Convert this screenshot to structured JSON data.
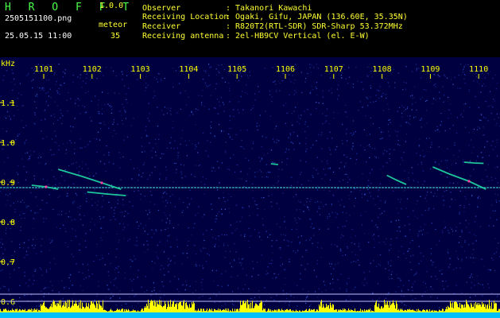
{
  "header": {
    "app_title": "H R O F F T",
    "app_version": "1.0.0",
    "file_name": "2505151100.png",
    "date_time": "25.05.15 11:00",
    "meteor_label": "meteor",
    "meteor_count": "35",
    "info": [
      {
        "key": "Observer",
        "value": ": Takanori Kawachi"
      },
      {
        "key": "Receiving Location",
        "value": ": Ogaki, Gifu, JAPAN (136.60E, 35.35N)"
      },
      {
        "key": "Receiver",
        "value": ": R820T2(RTL-SDR) SDR-Sharp 53.372MHz"
      },
      {
        "key": "Receiving antenna",
        "value": ": 2el-HB9CV Vertical (el. E-W)"
      }
    ]
  },
  "chart_data": {
    "type": "heatmap",
    "ylabel": "kHz",
    "x_ticks": [
      "1101",
      "1102",
      "1103",
      "1104",
      "1105",
      "1106",
      "1107",
      "1108",
      "1109",
      "1110"
    ],
    "y_ticks": [
      "1.1",
      "1.0",
      "0.9",
      "0.8",
      "0.7",
      "0.6"
    ],
    "xlim": [
      1100.6,
      1110.2
    ],
    "ylim": [
      0.585,
      1.18
    ],
    "carrier_khz": 0.886,
    "echoes": [
      {
        "x": [
          1100.75,
          1101.05,
          1101.3
        ],
        "y": [
          0.892,
          0.888,
          0.882
        ]
      },
      {
        "x": [
          1101.3,
          1101.8,
          1102.2,
          1102.6
        ],
        "y": [
          0.932,
          0.914,
          0.898,
          0.882
        ]
      },
      {
        "x": [
          1101.9,
          1102.3,
          1102.7
        ],
        "y": [
          0.875,
          0.87,
          0.866
        ]
      },
      {
        "x": [
          1105.7,
          1105.85
        ],
        "y": [
          0.946,
          0.944
        ]
      },
      {
        "x": [
          1108.1,
          1108.3,
          1108.5
        ],
        "y": [
          0.917,
          0.905,
          0.894
        ]
      },
      {
        "x": [
          1109.05,
          1109.4,
          1109.8,
          1110.15
        ],
        "y": [
          0.938,
          0.92,
          0.902,
          0.882
        ]
      },
      {
        "x": [
          1109.7,
          1109.9,
          1110.1
        ],
        "y": [
          0.95,
          0.948,
          0.947
        ]
      }
    ],
    "colors": {
      "background": "#000040",
      "axis_labels": "#ffff00",
      "echo_main": "#20d0a0",
      "echo_hot": "#ff40a0",
      "carrier": "#3fd0d0",
      "bottom_bars": "#ffff00",
      "bottom_base": "#00c0ff"
    }
  }
}
